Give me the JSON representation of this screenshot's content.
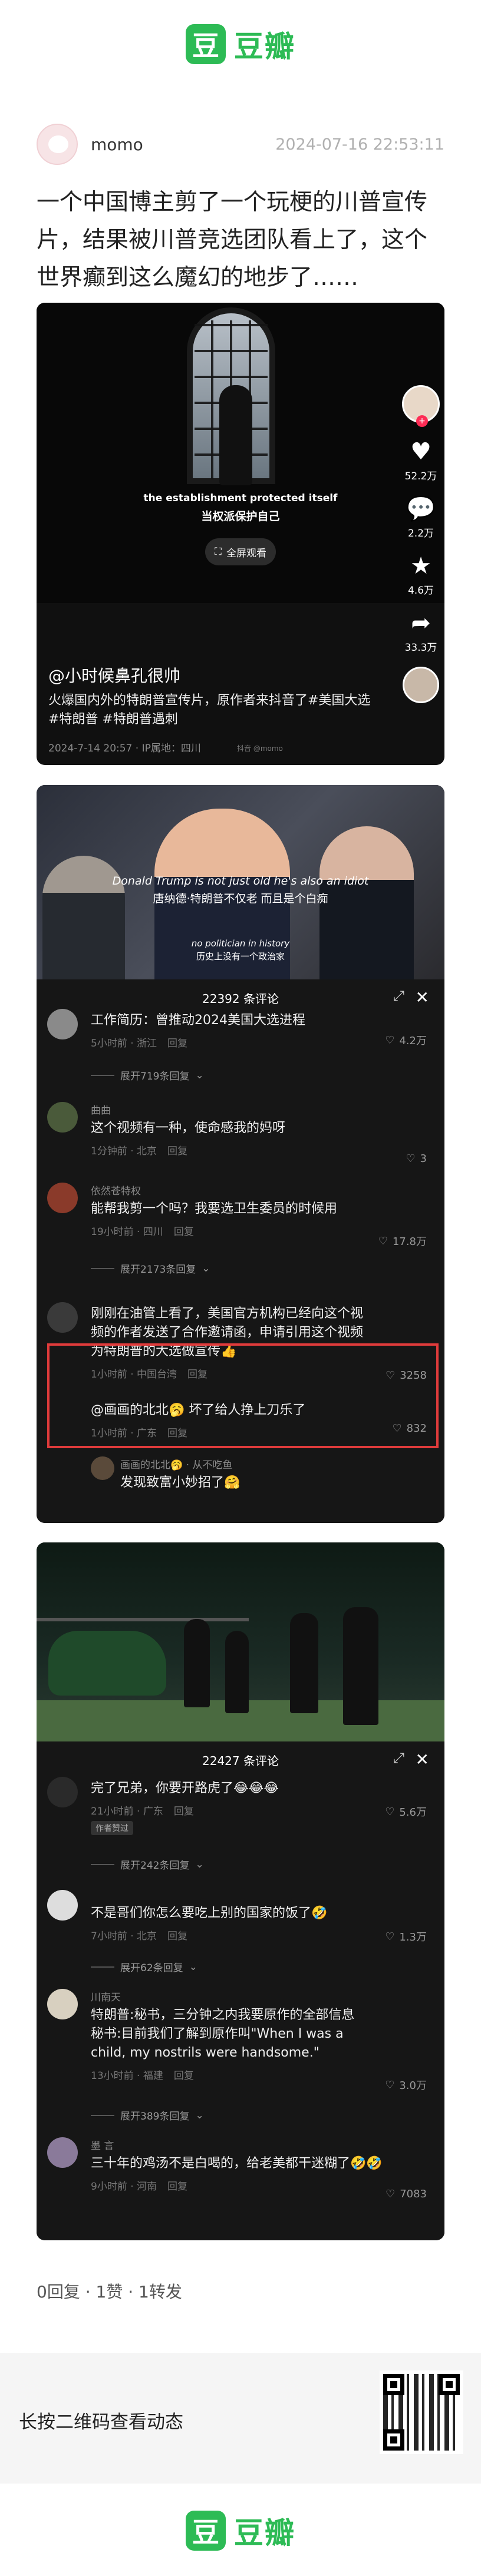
{
  "brand": {
    "logo_char": "豆",
    "name": "豆瓣"
  },
  "post": {
    "username": "momo",
    "timestamp": "2024-07-16 22:53:11",
    "text": "一个中国博主剪了一个玩梗的川普宣传片，结果被川普竞选团队看上了，这个世界癫到这么魔幻的地步了……"
  },
  "card1": {
    "subtitle_en": "the establishment protected itself",
    "subtitle_cn": "当权派保护自己",
    "fullscreen_label": "全屏观看",
    "likes": "52.2万",
    "comments": "2.2万",
    "favorites": "4.6万",
    "shares": "33.3万",
    "author": "@小时候鼻孔很帅",
    "description": "火爆国内外的特朗普宣传片，原作者来抖音了#美国大选 #特朗普 #特朗普遇刺",
    "meta": "2024-7-14 20:57 · IP属地：四川",
    "watermark": "抖音 @momo"
  },
  "card2": {
    "subtitle_en_1": "Donald Trump is not just old he's also an idiot",
    "subtitle_cn_1": "唐纳德·特朗普不仅老 而且是个白痴",
    "subtitle_en_2": "no politician in history",
    "subtitle_cn_2": "历史上没有一个政治家",
    "comment_count": "22392 条评论",
    "comments": [
      {
        "name": "",
        "text": "工作简历：曾推动2024美国大选进程",
        "meta": "5小时前 · 浙江",
        "reply": "回复",
        "likes": "4.2万"
      },
      {
        "name": "",
        "expand": "展开719条回复"
      },
      {
        "name": "曲曲",
        "text": "这个视频有一种，使命感我的妈呀",
        "meta": "1分钟前 · 北京",
        "reply": "回复",
        "likes": "3"
      },
      {
        "name": "依然苍特权",
        "text": "能帮我剪一个吗？我要选卫生委员的时候用",
        "meta": "19小时前 · 四川",
        "reply": "回复",
        "likes": "17.8万"
      },
      {
        "name": "",
        "expand": "展开2173条回复"
      },
      {
        "name": "",
        "text": "刚刚在油管上看了，美国官方机构已经向这个视频的作者发送了合作邀请函，申请引用这个视频为特朗普的大选做宣传👍",
        "meta": "1小时前 · 中国台湾",
        "reply": "回复",
        "likes": "3258"
      },
      {
        "name": "",
        "text": "@画画的北北🥱 坏了给人挣上刀乐了",
        "meta": "1小时前 · 广东",
        "reply": "回复",
        "likes": "832"
      },
      {
        "name": "画画的北北🥱 · 从不吃鱼",
        "text": "发现致富小妙招了🤗",
        "meta": "",
        "reply": "",
        "likes": ""
      }
    ]
  },
  "card3": {
    "comment_count": "22427 条评论",
    "comments": [
      {
        "name": "",
        "text": "完了兄弟，你要开路虎了😂😂😂",
        "meta": "21小时前 · 广东",
        "reply": "回复",
        "likes": "5.6万",
        "tag": "作者赞过"
      },
      {
        "name": "",
        "expand": "展开242条回复"
      },
      {
        "name": "",
        "text": "不是哥们你怎么要吃上别的国家的饭了🤣",
        "meta": "7小时前 · 北京",
        "reply": "回复",
        "likes": "1.3万"
      },
      {
        "name": "",
        "expand": "展开62条回复"
      },
      {
        "name": "川南天",
        "text": "特朗普:秘书，三分钟之内我要原作的全部信息\n秘书:目前我们了解到原作叫\"When I was a child, my nostrils were handsome.\"",
        "meta": "13小时前 · 福建",
        "reply": "回复",
        "likes": "3.0万"
      },
      {
        "name": "",
        "expand": "展开389条回复"
      },
      {
        "name": "墨 言",
        "text": "三十年的鸡汤不是白喝的，给老美都干迷糊了🤣🤣",
        "meta": "9小时前 · 河南",
        "reply": "回复",
        "likes": "7083"
      }
    ]
  },
  "footer": {
    "stats": "0回复 · 1赞 · 1转发",
    "qr_text": "长按二维码查看动态"
  }
}
